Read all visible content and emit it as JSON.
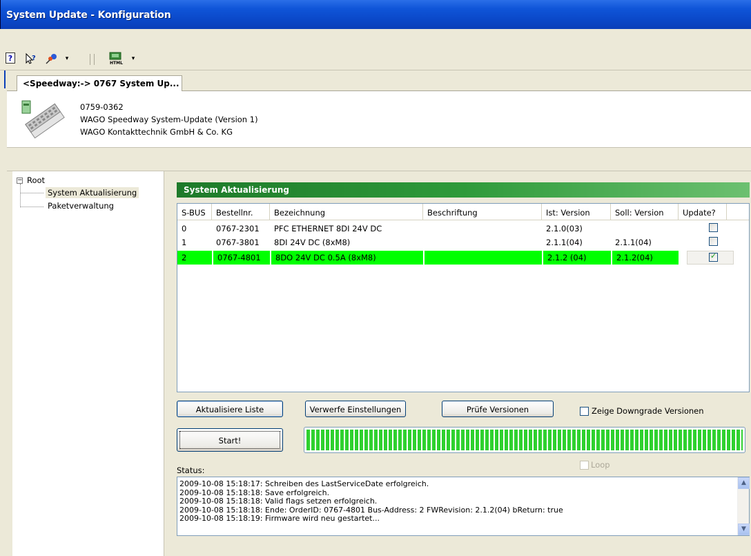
{
  "window": {
    "title": "System Update - Konfiguration"
  },
  "toolbar": {
    "icons": [
      "help-icon",
      "context-help-icon",
      "pointer-icon",
      "dropdown-icon",
      "html-export-icon",
      "dropdown-icon"
    ],
    "help_glyph": "?",
    "html_glyph": "HTML"
  },
  "tab": {
    "label": "<Speedway:-> 0767 System Up..."
  },
  "device": {
    "order_no": "0759-0362",
    "name": "WAGO Speedway System-Update (Version 1)",
    "vendor": "WAGO Kontakttechnik GmbH & Co. KG"
  },
  "tree": {
    "root": "Root",
    "expander": "−",
    "items": [
      "System Aktualisierung",
      "Paketverwaltung"
    ],
    "selected_index": 0
  },
  "section": {
    "title": "System Aktualisierung"
  },
  "table": {
    "columns": [
      "S-BUS",
      "Bestellnr.",
      "Bezeichnung",
      "Beschriftung",
      "Ist: Version",
      "Soll: Version",
      "Update?"
    ],
    "rows": [
      {
        "sbus": "0",
        "order": "0767-2301",
        "name": "PFC ETHERNET 8DI 24V DC",
        "label": "",
        "ist": "2.1.0(03)",
        "soll": "",
        "update": false,
        "selected": false
      },
      {
        "sbus": "1",
        "order": "0767-3801",
        "name": "8DI 24V DC (8xM8)",
        "label": "",
        "ist": "2.1.1(04)",
        "soll": "2.1.1(04)",
        "update": false,
        "selected": false
      },
      {
        "sbus": "2",
        "order": "0767-4801",
        "name": "8DO 24V DC 0.5A (8xM8)",
        "label": "",
        "ist": "2.1.2 (04)",
        "soll": "2.1.2(04)",
        "update": true,
        "selected": true
      }
    ],
    "highlight_color": "#00ff00"
  },
  "buttons": {
    "refresh": "Aktualisiere Liste",
    "discard": "Verwerfe Einstellungen",
    "check": "Prüfe Versionen",
    "start": "Start!"
  },
  "options": {
    "downgrade_label": "Zeige Downgrade Versionen",
    "downgrade_checked": false,
    "loop_label": "Loop",
    "loop_checked": false
  },
  "progress": {
    "fraction": 1.0,
    "color": "#2fd12f"
  },
  "status": {
    "label": "Status:",
    "lines": [
      "2009-10-08 15:18:17: Schreiben des LastServiceDate erfolgreich.",
      "2009-10-08 15:18:18: Save erfolgreich.",
      "2009-10-08 15:18:18: Valid flags setzen erfolgreich.",
      "2009-10-08 15:18:18: Ende: OrderID: 0767-4801 Bus-Address: 2 FWRevision: 2.1.2(04) bReturn: true",
      "2009-10-08 15:18:19: Firmware wird neu gestartet..."
    ],
    "scroll_up": "▲",
    "scroll_down": "▼"
  }
}
